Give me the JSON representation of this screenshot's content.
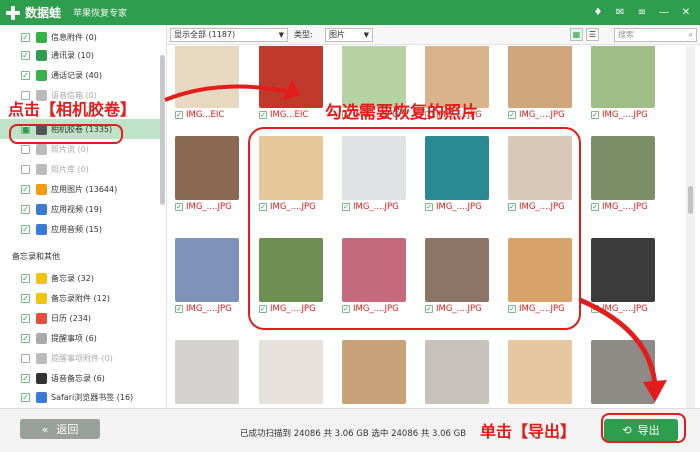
{
  "window": {
    "app_name": "数据蛙",
    "subtitle": "苹果恢复专家",
    "controls": [
      "♦",
      "✉",
      "≡",
      "—",
      "✕"
    ]
  },
  "sidebar": {
    "items": [
      {
        "label": "信息附件 (0)",
        "checked": true,
        "icon_color": "#35b34a",
        "icon": "chat-icon"
      },
      {
        "label": "通讯录 (10)",
        "checked": true,
        "icon_color": "#2f9d4e",
        "icon": "contacts-icon"
      },
      {
        "label": "通话记录 (40)",
        "checked": true,
        "icon_color": "#35b34a",
        "icon": "phone-icon"
      },
      {
        "label": "语音信箱 (0)",
        "checked": false,
        "disabled": true,
        "icon_color": "#bbb",
        "icon": "voicemail-icon"
      },
      {
        "label": "相机胶卷 (1335)",
        "checked": true,
        "selected": true,
        "icon_color": "#555",
        "icon": "camera-icon"
      },
      {
        "label": "照片流 (0)",
        "checked": false,
        "disabled": true,
        "icon_color": "#bbb",
        "icon": "photostream-icon"
      },
      {
        "label": "照片库 (0)",
        "checked": false,
        "disabled": true,
        "icon_color": "#bbb",
        "icon": "photolibrary-icon"
      },
      {
        "label": "应用图片 (13644)",
        "checked": true,
        "icon_color": "#f39c12",
        "icon": "app-photo-icon"
      },
      {
        "label": "应用视频 (19)",
        "checked": true,
        "icon_color": "#3a7bd5",
        "icon": "app-video-icon"
      },
      {
        "label": "应用音频 (15)",
        "checked": true,
        "icon_color": "#3a7bd5",
        "icon": "app-audio-icon"
      },
      {
        "label": "备忘录 (32)",
        "checked": true,
        "icon_color": "#f1c40f",
        "icon": "notes-icon"
      },
      {
        "label": "备忘录附件 (12)",
        "checked": true,
        "icon_color": "#f1c40f",
        "icon": "notes-attachment-icon"
      },
      {
        "label": "日历 (234)",
        "checked": true,
        "icon_color": "#e74c3c",
        "icon": "calendar-icon"
      },
      {
        "label": "提醒事项 (6)",
        "checked": true,
        "icon_color": "#aaa",
        "icon": "reminder-icon"
      },
      {
        "label": "提醒事项附件 (0)",
        "checked": false,
        "disabled": true,
        "icon_color": "#bbb",
        "icon": "reminder-attachment-icon"
      },
      {
        "label": "语音备忘录 (6)",
        "checked": true,
        "icon_color": "#333",
        "icon": "voice-memo-icon"
      },
      {
        "label": "Safari浏览器书签 (16)",
        "checked": true,
        "icon_color": "#3a7bd5",
        "icon": "safari-icon"
      }
    ],
    "section_label": "备忘录和其他"
  },
  "filter": {
    "show_select": "显示全部 (1187)",
    "type_label": "类型:",
    "type_select": "图片",
    "search_placeholder": "搜索"
  },
  "grid": {
    "rows": [
      [
        {
          "caption": "IMG...EIC",
          "color": "#e8d8c0"
        },
        {
          "caption": "IMG...EIC",
          "color": "#c0392b"
        },
        {
          "caption": "IMG_....JPG",
          "color": "#b7d3a5"
        },
        {
          "caption": "IMG_....JPG",
          "color": "#d9b48a"
        },
        {
          "caption": "IMG_....JPG",
          "color": "#cfa77a"
        },
        {
          "caption": "IMG_....JPG",
          "color": "#9fbf86"
        }
      ],
      [
        {
          "caption": "IMG_....JPG",
          "color": "#8a6a52"
        },
        {
          "caption": "IMG_....JPG",
          "color": "#e7c89a"
        },
        {
          "caption": "IMG_....JPG",
          "color": "#dfe3e6"
        },
        {
          "caption": "IMG_....JPG",
          "color": "#2a8a93"
        },
        {
          "caption": "IMG_....JPG",
          "color": "#d9c7b8"
        },
        {
          "caption": "IMG_....JPG",
          "color": "#7c8e67"
        }
      ],
      [
        {
          "caption": "IMG_....JPG",
          "color": "#7f93b8"
        },
        {
          "caption": "IMG_....JPG",
          "color": "#6e8f52"
        },
        {
          "caption": "IMG_....JPG",
          "color": "#c46a7c"
        },
        {
          "caption": "IMG_....JPG",
          "color": "#8c7566"
        },
        {
          "caption": "IMG_....JPG",
          "color": "#d9a26a"
        },
        {
          "caption": "IMG_....JPG",
          "color": "#3b3b3b"
        }
      ],
      [
        {
          "caption": "",
          "color": "#d5d2cf"
        },
        {
          "caption": "",
          "color": "#e6e1dc"
        },
        {
          "caption": "",
          "color": "#c9a27a"
        },
        {
          "caption": "",
          "color": "#c9c2bc"
        },
        {
          "caption": "",
          "color": "#e6c7a1"
        },
        {
          "caption": "",
          "color": "#8e8a86"
        }
      ]
    ]
  },
  "footer": {
    "back_label": "返回",
    "status": "已成功扫描到 24086 共 3.06 GB  选中 24086 共 3.06 GB",
    "export_label": "导出"
  },
  "annotations": {
    "step1": "点击【相机胶卷】",
    "step2": "勾选需要恢复的照片",
    "step3": "单击【导出】",
    "color": "#e31c1c"
  }
}
